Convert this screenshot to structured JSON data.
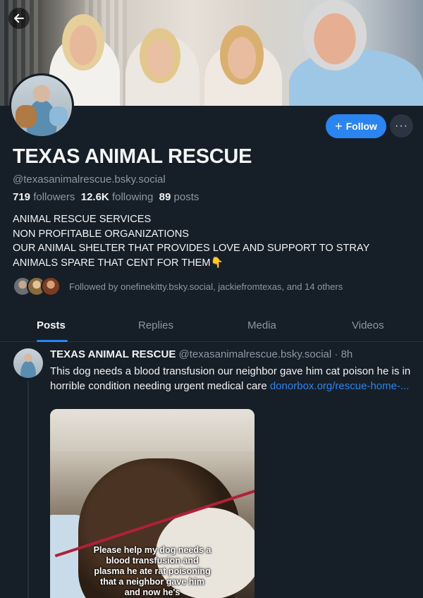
{
  "profile": {
    "display_name": "TEXAS ANIMAL RESCUE",
    "handle": "@texasanimalrescue.bsky.social",
    "followers_count": "719",
    "followers_label": "followers",
    "following_count": "12.6K",
    "following_label": "following",
    "posts_count": "89",
    "posts_label": "posts",
    "bio_lines": [
      "ANIMAL RESCUE SERVICES",
      "NON PROFITABLE ORGANIZATIONS",
      "OUR ANIMAL SHELTER THAT PROVIDES LOVE AND SUPPORT TO STRAY",
      "ANIMALS SPARE THAT CENT FOR THEM👇"
    ],
    "followed_by": "Followed by onefinekitty.bsky.social, jackiefromtexas, and 14 others"
  },
  "actions": {
    "follow_label": "Follow",
    "follow_icon": "+",
    "more_icon": "···"
  },
  "tabs": [
    {
      "label": "Posts",
      "active": true
    },
    {
      "label": "Replies",
      "active": false
    },
    {
      "label": "Media",
      "active": false
    },
    {
      "label": "Videos",
      "active": false
    }
  ],
  "post": {
    "author_name": "TEXAS ANIMAL RESCUE",
    "author_handle": "@texasanimalrescue.bsky.social",
    "separator": " · ",
    "time": "8h",
    "text": "This dog needs a blood transfusion our neighbor gave him cat poison he is in horrible condition needing urgent medical care ",
    "link_text": "donorbox.org/rescue-home-...",
    "image_caption": "Please help my dog needs a blood transfusion and plasma he ate rat poisoning that a neighbor gave him and now he's"
  },
  "colors": {
    "background": "#161e27",
    "accent": "#2a85f0",
    "muted_text": "#8b98a5",
    "primary_text": "#f1f3f5"
  },
  "icons": {
    "back": "arrow-left-icon",
    "more": "ellipsis-icon"
  }
}
